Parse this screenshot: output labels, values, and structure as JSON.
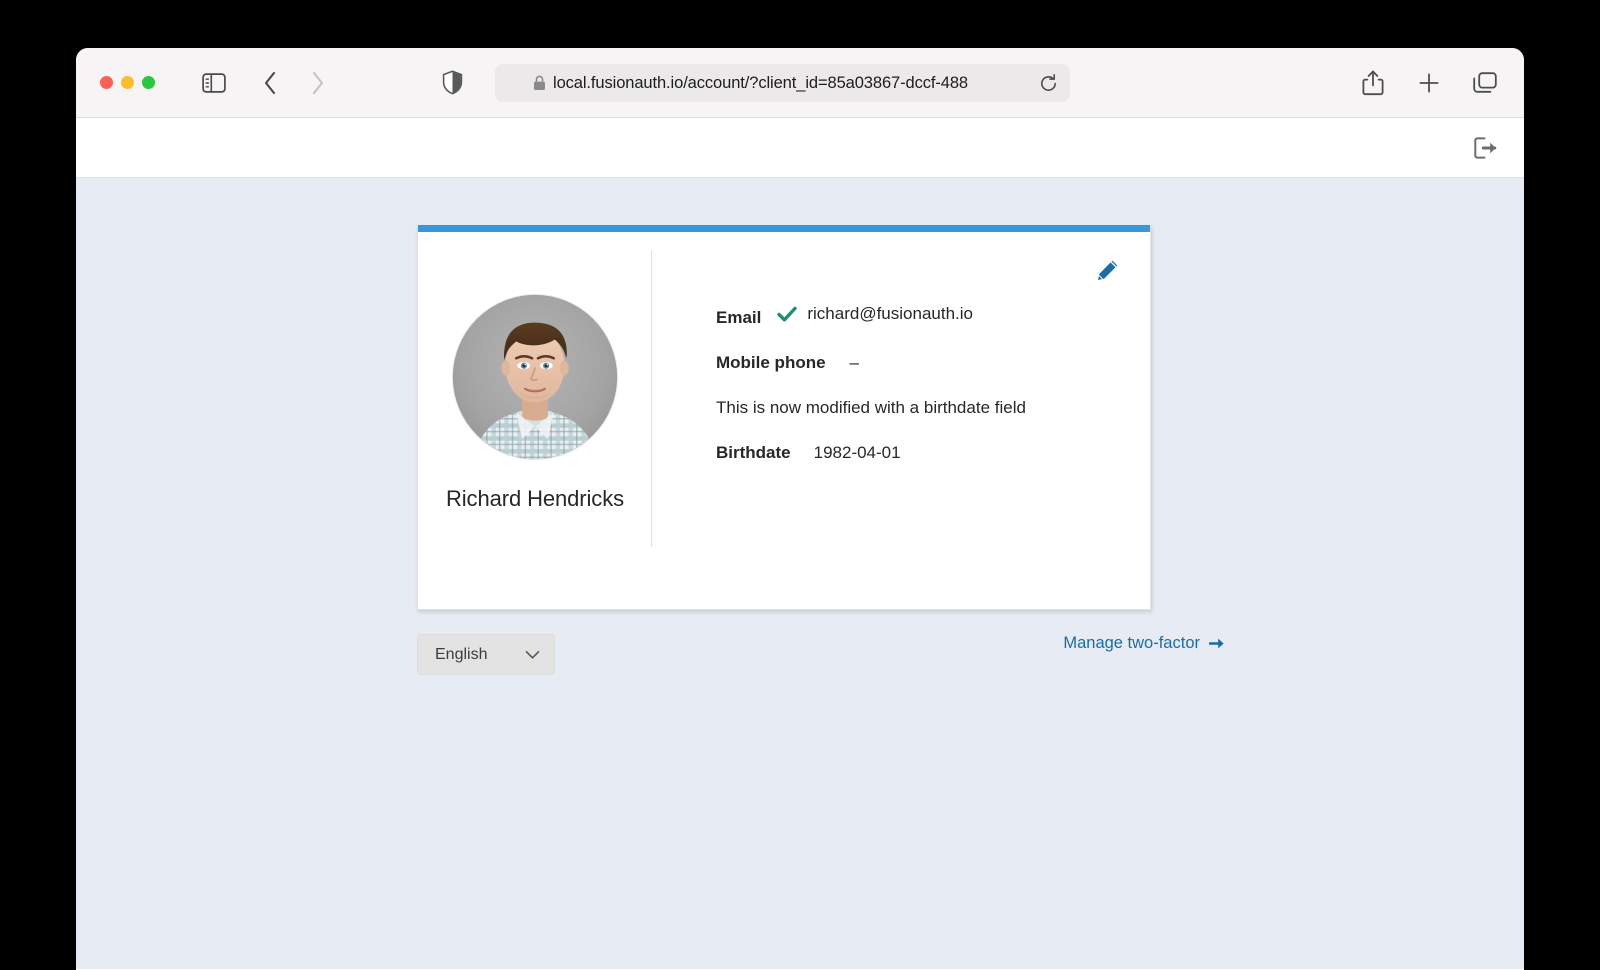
{
  "browser": {
    "url": "local.fusionauth.io/account/?client_id=85a03867-dccf-488",
    "lock_icon": "lock-icon",
    "shield_icon": "shield-icon",
    "reload_icon": "reload-icon",
    "sidebar_icon": "sidebar-toggle-icon",
    "back_icon": "chevron-left-icon",
    "forward_icon": "chevron-right-icon",
    "share_icon": "share-icon",
    "new_tab_icon": "plus-icon",
    "tabs_icon": "tab-overview-icon",
    "traffic_lights": [
      "close",
      "minimize",
      "maximize"
    ]
  },
  "app": {
    "navbar": {
      "logout_icon": "logout-icon"
    },
    "card": {
      "accent_color": "#3498db",
      "edit_icon": "pencil-icon",
      "profile": {
        "name": "Richard Hendricks",
        "avatar_alt": "user-avatar"
      },
      "details": [
        {
          "label": "Email",
          "value": "richard@fusionauth.io",
          "verified": true,
          "verified_color": "#1a9172"
        },
        {
          "label": "Mobile phone",
          "value": "–",
          "verified": false
        }
      ],
      "note": "This is now modified with a birthdate field",
      "birthdate": {
        "label": "Birthdate",
        "value": "1982-04-01"
      }
    },
    "footer": {
      "locale_value": "English",
      "locale_chevron_icon": "chevron-down-icon",
      "two_factor_label": "Manage two-factor",
      "two_factor_arrow_icon": "arrow-right-icon",
      "link_color": "#1b6ca8"
    }
  }
}
